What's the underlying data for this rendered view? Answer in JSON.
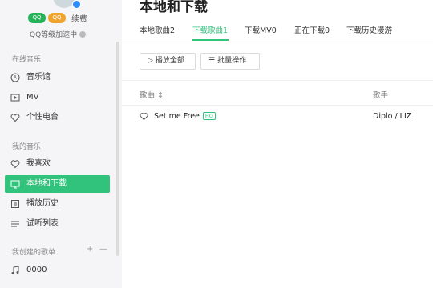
{
  "profile": {
    "badges": [
      "QQ",
      "QQ"
    ],
    "renew_label": "续费",
    "vip_status": "QQ等级加速中"
  },
  "sidebar": {
    "online_section": "在线音乐",
    "online_items": [
      {
        "label": "音乐馆",
        "icon": "music-hall-icon"
      },
      {
        "label": "MV",
        "icon": "mv-icon"
      },
      {
        "label": "个性电台",
        "icon": "radio-icon"
      }
    ],
    "mine_section": "我的音乐",
    "mine_items": [
      {
        "label": "我喜欢",
        "icon": "heart-icon"
      },
      {
        "label": "本地和下载",
        "icon": "computer-icon",
        "active": true
      },
      {
        "label": "播放历史",
        "icon": "clock-icon"
      },
      {
        "label": "试听列表",
        "icon": "list-icon"
      }
    ],
    "created_section": "我创建的歌单",
    "created_add": "+",
    "created_collapse": "—",
    "created_items": [
      {
        "label": "0000",
        "icon": "note-icon"
      }
    ]
  },
  "main": {
    "title": "本地和下载",
    "tabs": [
      {
        "label": "本地歌曲2"
      },
      {
        "label": "下载歌曲1",
        "active": true
      },
      {
        "label": "下载MV0"
      },
      {
        "label": "正在下载0"
      },
      {
        "label": "下载历史漫游"
      }
    ],
    "play_all_label": "播放全部",
    "batch_label": "批量操作",
    "columns": {
      "song": "歌曲",
      "artist": "歌手"
    },
    "songs": [
      {
        "title": "Set me Free",
        "quality": "HQ",
        "artist": "Diplo / LIZ"
      }
    ]
  },
  "colors": {
    "accent": "#31c27c",
    "sidebar_bg": "#f5f5f7"
  }
}
